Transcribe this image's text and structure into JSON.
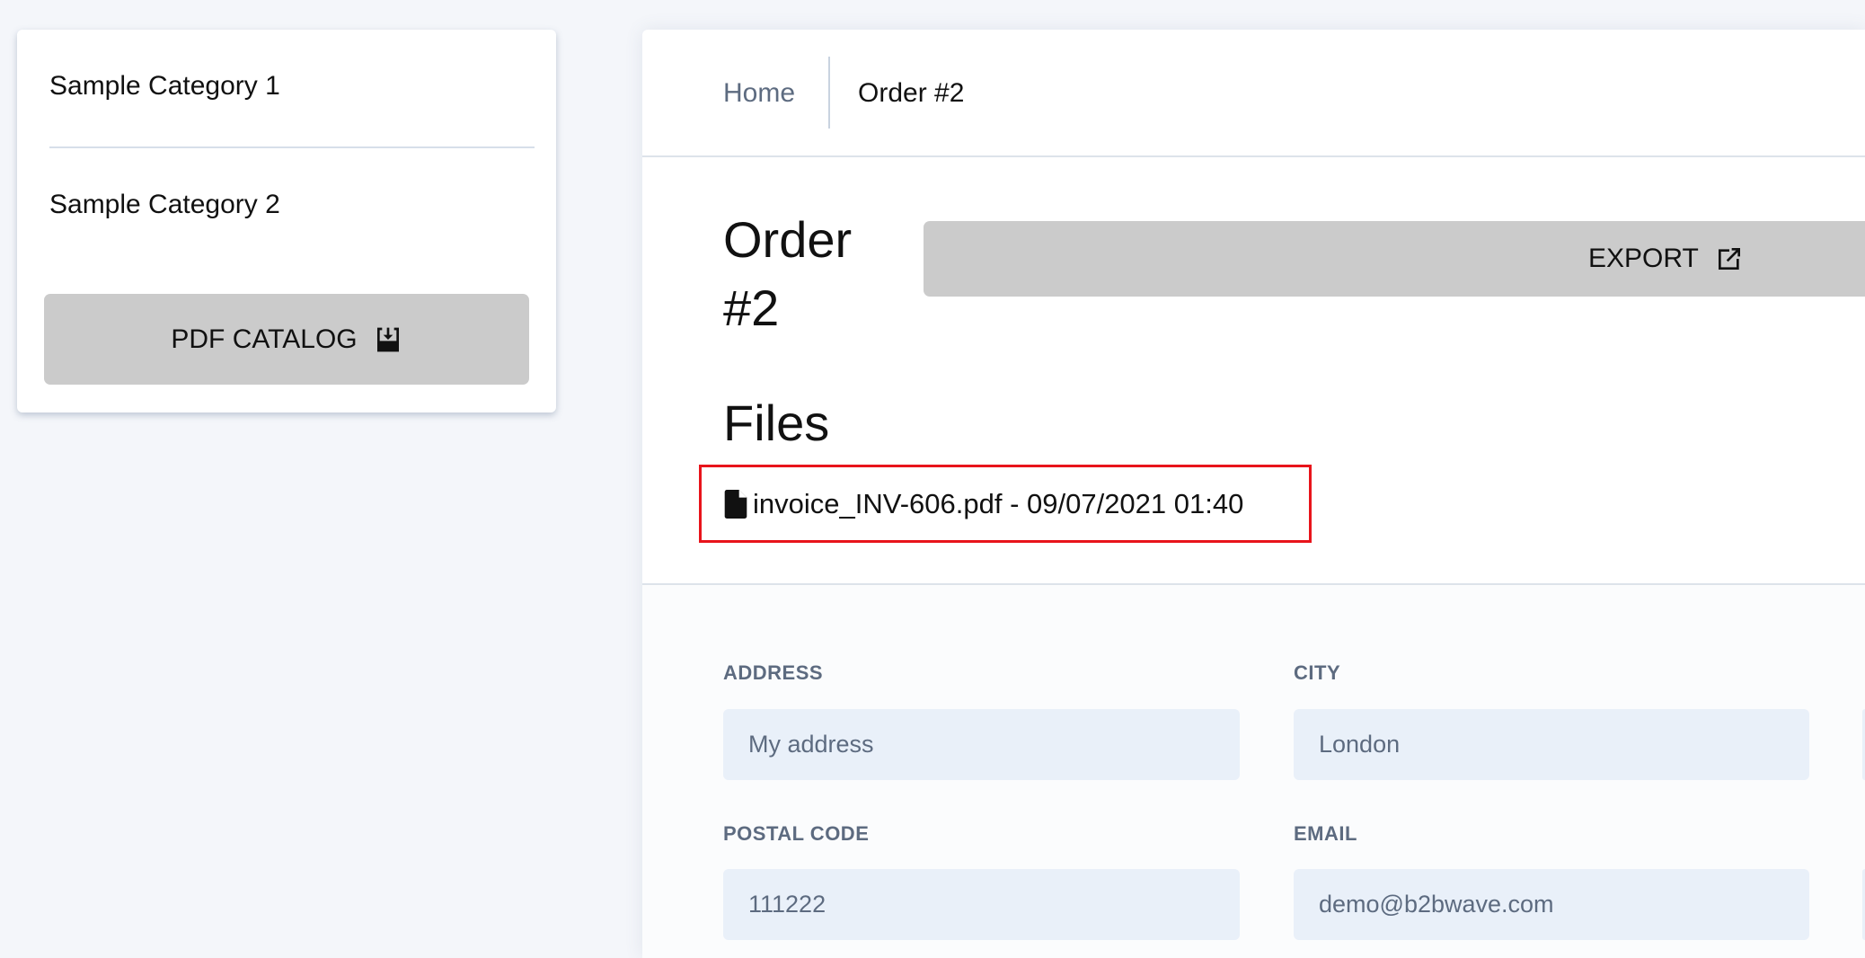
{
  "sidebar": {
    "categories": [
      "Sample Category 1",
      "Sample Category 2"
    ],
    "pdf_button": "PDF CATALOG",
    "pdf_icon": "download-icon"
  },
  "breadcrumb": {
    "home": "Home",
    "current": "Order #2"
  },
  "order": {
    "title_line1": "Order",
    "title_line2": "#2",
    "export_label": "EXPORT",
    "export_icon": "external-link-icon"
  },
  "files": {
    "heading": "Files",
    "items": [
      {
        "icon": "file-icon",
        "text": "invoice_INV-606.pdf - 09/07/2021 01:40"
      }
    ],
    "highlight_color": "#e8141b"
  },
  "form": {
    "address": {
      "label": "ADDRESS",
      "value": "My address"
    },
    "city": {
      "label": "CITY",
      "value": "London"
    },
    "postal_code": {
      "label": "POSTAL CODE",
      "value": "111222"
    },
    "email": {
      "label": "EMAIL",
      "value": "demo@b2bwave.com"
    }
  }
}
